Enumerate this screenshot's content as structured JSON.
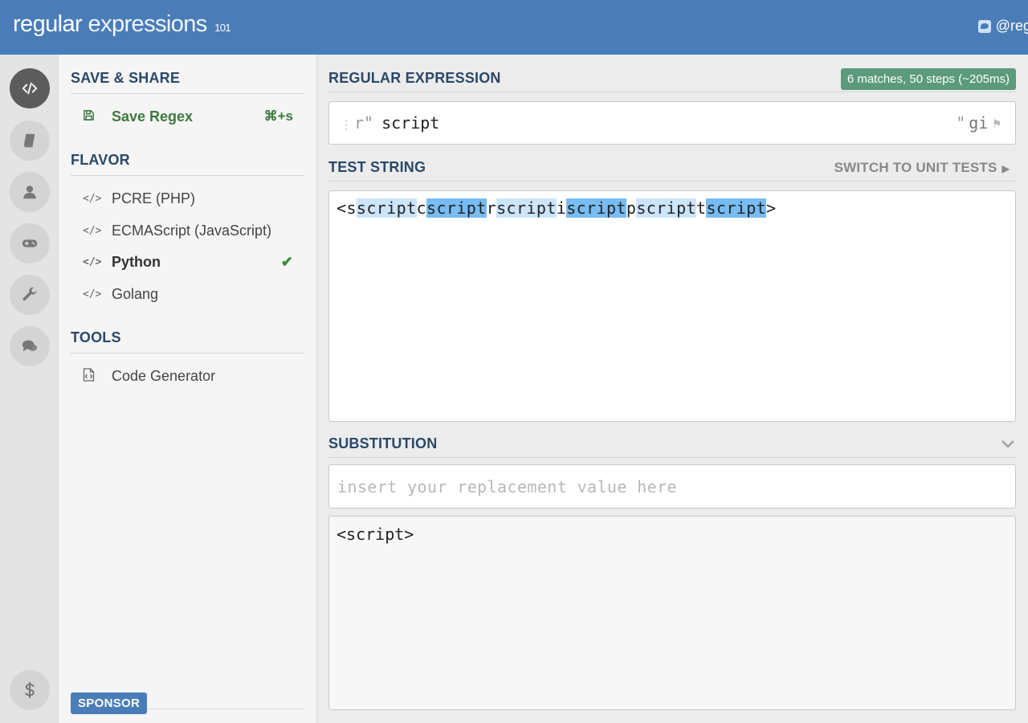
{
  "header": {
    "logo_part1": "regular",
    "logo_part2": "expressions",
    "logo_version": "101",
    "twitter_handle": "@reg"
  },
  "rail": {
    "icons": [
      "code-icon",
      "book-icon",
      "user-icon",
      "gamepad-icon",
      "wrench-icon",
      "chat-icon",
      "dollar-icon"
    ]
  },
  "sidebar": {
    "save_share_title": "SAVE & SHARE",
    "save_label": "Save Regex",
    "save_shortcut": "⌘+s",
    "flavor_title": "FLAVOR",
    "flavors": [
      {
        "label": "PCRE (PHP)",
        "selected": false
      },
      {
        "label": "ECMAScript (JavaScript)",
        "selected": false
      },
      {
        "label": "Python",
        "selected": true
      },
      {
        "label": "Golang",
        "selected": false
      }
    ],
    "tools_title": "TOOLS",
    "tools": [
      {
        "label": "Code Generator"
      }
    ],
    "sponsor_label": "SPONSOR"
  },
  "main": {
    "regex_title": "REGULAR EXPRESSION",
    "match_badge": "6 matches, 50 steps (~205ms)",
    "regex_prefix": "r\"",
    "regex_value": "script",
    "regex_suffix": "\"",
    "regex_flags": "gi",
    "test_title": "TEST STRING",
    "switch_label": "SWITCH TO UNIT TESTS",
    "test_segments": [
      {
        "text": "<s",
        "match": 0
      },
      {
        "text": "script",
        "match": 1
      },
      {
        "text": "c",
        "match": 0
      },
      {
        "text": "script",
        "match": 2
      },
      {
        "text": "r",
        "match": 0
      },
      {
        "text": "script",
        "match": 1
      },
      {
        "text": "i",
        "match": 0
      },
      {
        "text": "script",
        "match": 2
      },
      {
        "text": "p",
        "match": 0
      },
      {
        "text": "script",
        "match": 1
      },
      {
        "text": "t",
        "match": 0
      },
      {
        "text": "script",
        "match": 2
      },
      {
        "text": ">",
        "match": 0
      }
    ],
    "substitution_title": "SUBSTITUTION",
    "substitution_placeholder": "insert your replacement value here",
    "substitution_value": "",
    "substitution_result": "<script>"
  },
  "colors": {
    "header_bg": "#4a7db8",
    "match_light": "#cde5fb",
    "match_dark": "#77bcf4",
    "badge_bg": "#5b9a7c",
    "save_green": "#3d7a3d"
  }
}
